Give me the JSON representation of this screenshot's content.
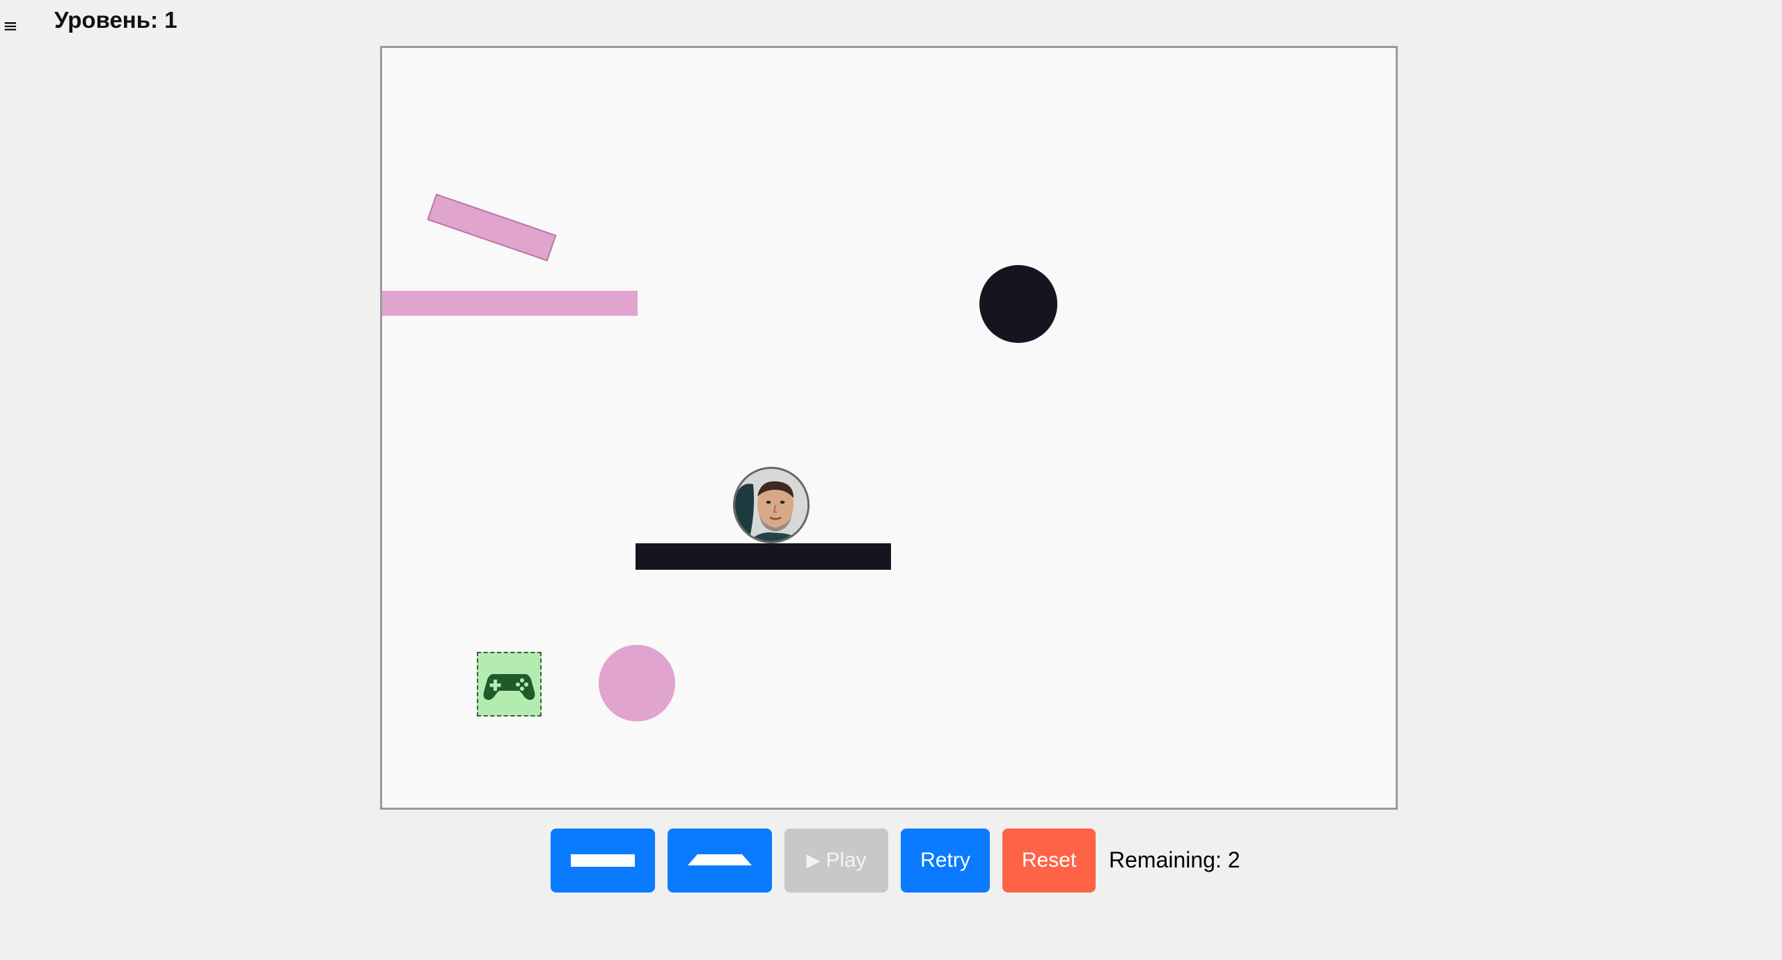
{
  "header": {
    "menu_icon": "≡",
    "level_label": "Уровень: 1"
  },
  "board": {
    "background": "#f9f9f9",
    "colors": {
      "pink": "#e0a4cf",
      "dark": "#15151f",
      "target_fill": "#b4ecb0"
    },
    "target_icon": "gamepad-icon",
    "player_icon": "face-avatar"
  },
  "toolbar": {
    "tools": [
      {
        "icon": "plank-icon"
      },
      {
        "icon": "ramp-icon"
      }
    ],
    "play_label": "Play",
    "play_enabled": false,
    "retry_label": "Retry",
    "reset_label": "Reset",
    "remaining_label": "Remaining: 2",
    "colors": {
      "primary": "#0a7bff",
      "danger": "#ff6347",
      "disabled": "#c8c8c8"
    }
  }
}
